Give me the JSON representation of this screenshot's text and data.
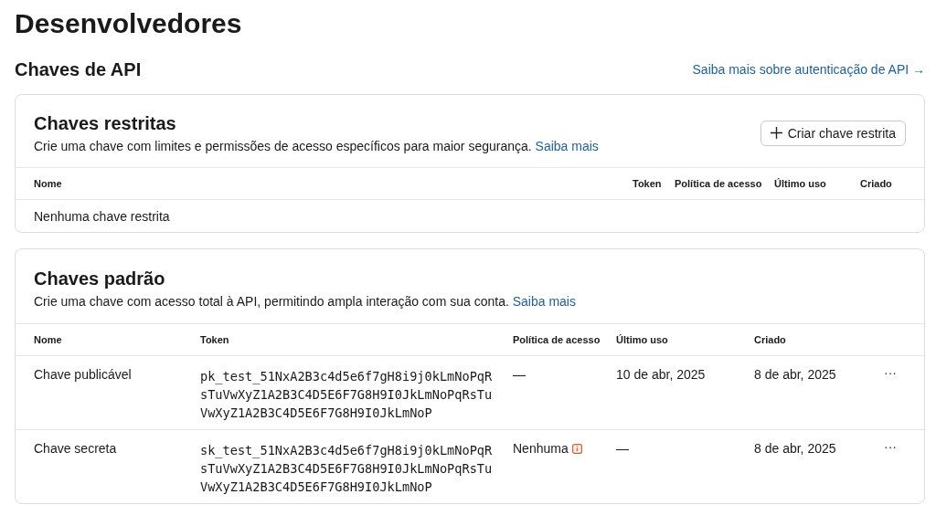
{
  "page_title": "Desenvolvedores",
  "section": {
    "title": "Chaves de API",
    "link": "Saiba mais sobre autenticação de API →"
  },
  "restricted": {
    "title": "Chaves restritas",
    "description": "Crie uma chave com limites e permissões de acesso específicos para maior segurança.",
    "link": "Saiba mais",
    "button": "Criar chave restrita",
    "columns": [
      "Nome",
      "Token",
      "Política de acesso",
      "Último uso",
      "Criado"
    ],
    "empty": "Nenhuma chave restrita"
  },
  "standard": {
    "title": "Chaves padrão",
    "description": "Crie uma chave com acesso total à API, permitindo ampla interação com sua conta.",
    "link": "Saiba mais",
    "columns": [
      "Nome",
      "Token",
      "Política de acesso",
      "Último uso",
      "Criado"
    ],
    "rows": [
      {
        "name": "Chave publicável",
        "token": "pk_test_51NxA2B3c4d5e6f7gH8i9j0kLmNoPqRsTuVwXyZ1A2B3C4D5E6F7G8H9I0JkLmNoPqRsTuVwXyZ1A2B3C4D5E6F7G8H9I0JkLmNoP",
        "policy": "—",
        "policy_warning": false,
        "last_used": "10 de abr, 2025",
        "created": "8 de abr, 2025",
        "menu": "···"
      },
      {
        "name": "Chave secreta",
        "token": "sk_test_51NxA2B3c4d5e6f7gH8i9j0kLmNoPqRsTuVwXyZ1A2B3C4D5E6F7G8H9I0JkLmNoPqRsTuVwXyZ1A2B3C4D5E6F7G8H9I0JkLmNoP",
        "policy": "Nenhuma",
        "policy_warning": true,
        "last_used": "—",
        "created": "8 de abr, 2025",
        "menu": "···"
      }
    ]
  }
}
